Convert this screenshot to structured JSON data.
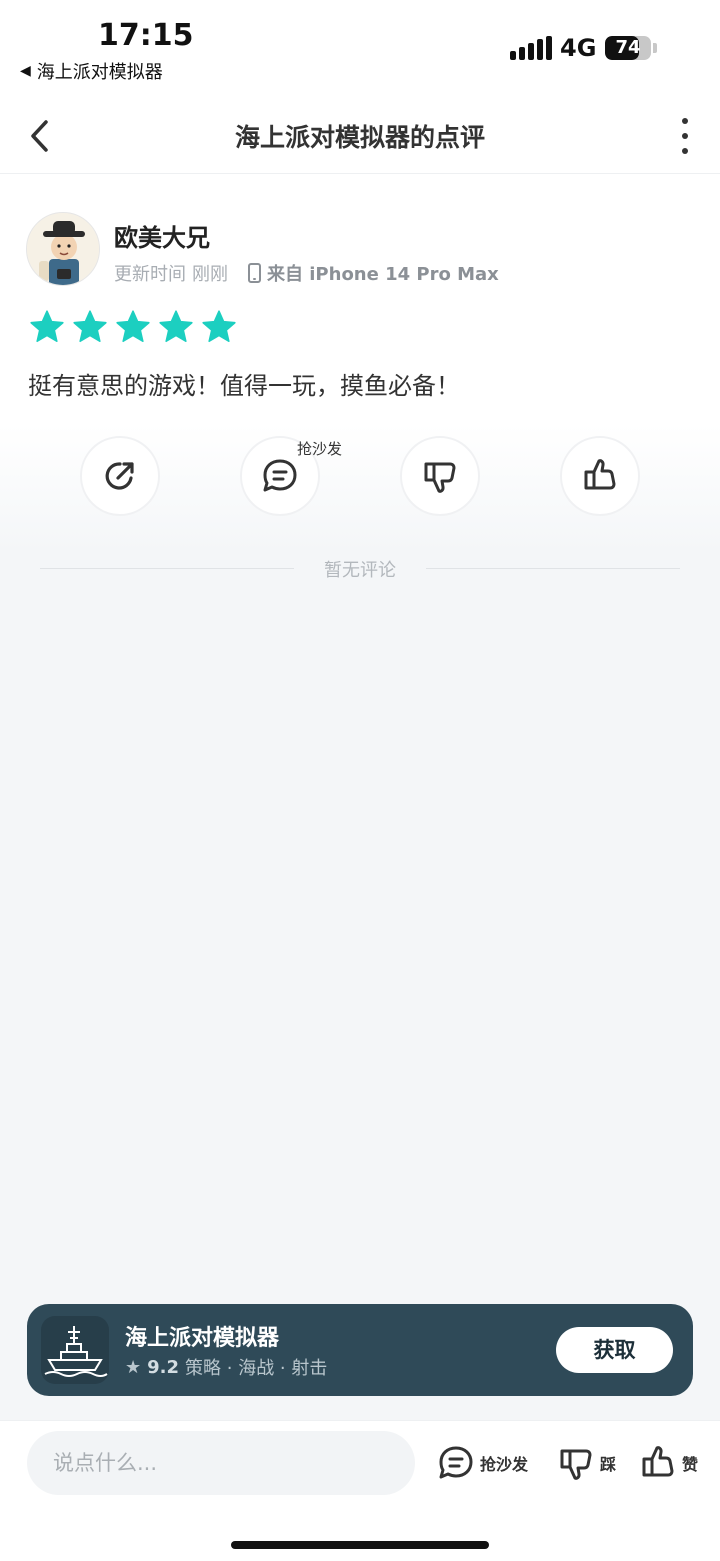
{
  "status_bar": {
    "time": "17:15",
    "back_app": "海上派对模拟器",
    "network": "4G",
    "battery": "74",
    "battery_level": 0.74
  },
  "nav": {
    "title": "海上派对模拟器的点评"
  },
  "review": {
    "user_name": "欧美大兄",
    "update_label": "更新时间",
    "update_time": "刚刚",
    "device": "来自 iPhone 14 Pro Max",
    "rating": 5,
    "text": "挺有意思的游戏！值得一玩，摸鱼必备！",
    "sofa_tag": "抢沙发"
  },
  "comments": {
    "empty_text": "暂无评论"
  },
  "app_banner": {
    "name": "海上派对模拟器",
    "rating": "9.2",
    "tags": "策略 · 海战 · 射击",
    "get_label": "获取"
  },
  "bottom_bar": {
    "input_placeholder": "说点什么...",
    "sofa_label": "抢沙发",
    "dislike_label": "踩",
    "like_label": "赞"
  },
  "colors": {
    "star": "#1ccfc0",
    "banner_bg": "#2f4a58"
  },
  "icons": [
    "chevron-left-icon",
    "more-vertical-icon",
    "share-icon",
    "comment-icon",
    "thumbs-down-icon",
    "thumbs-up-icon",
    "star-icon",
    "phone-icon"
  ]
}
